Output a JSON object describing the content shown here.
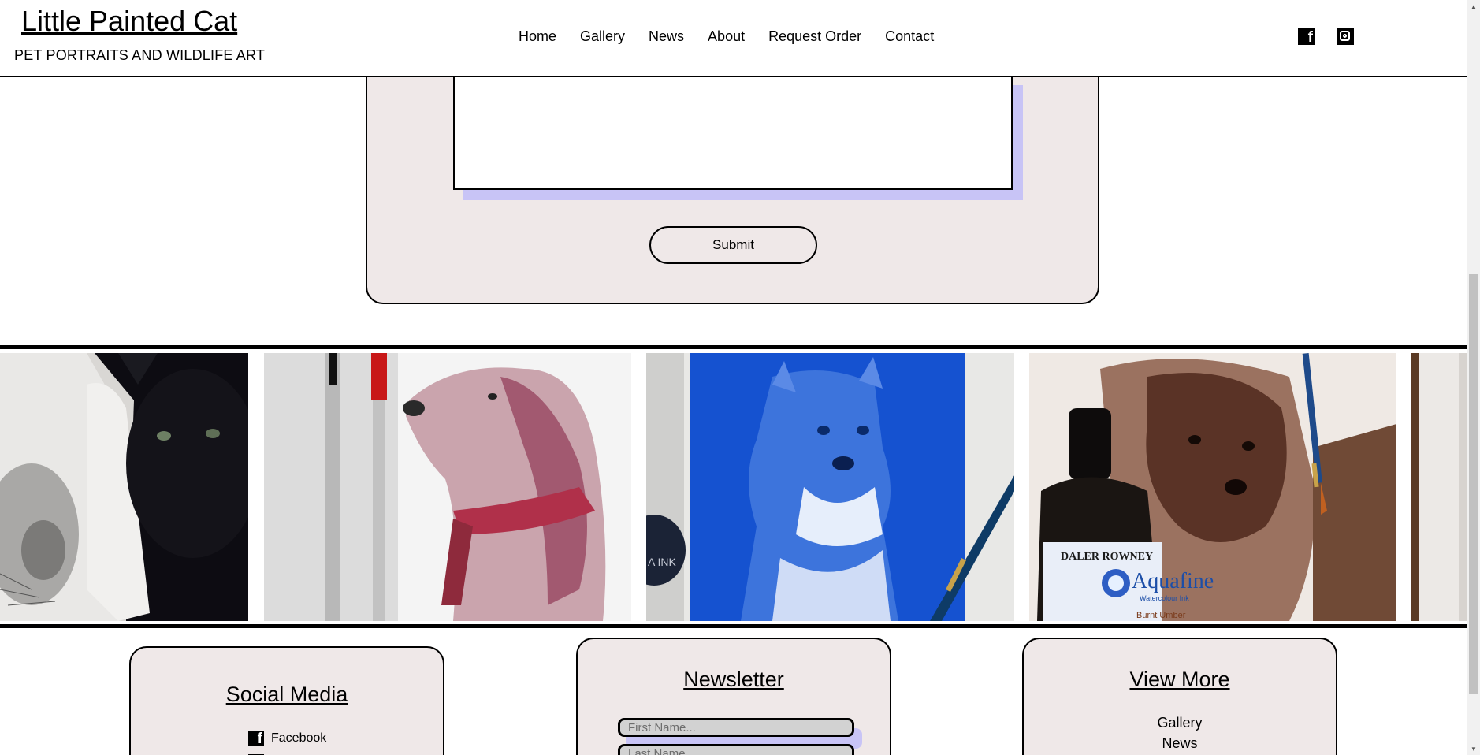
{
  "header": {
    "site_title": "Little Painted Cat",
    "tagline": "PET PORTRAITS AND WILDLIFE ART",
    "nav": [
      "Home",
      "Gallery",
      "News",
      "About",
      "Request Order",
      "Contact"
    ],
    "social_icons": [
      "facebook-icon",
      "instagram-icon"
    ]
  },
  "form": {
    "textarea_value": "",
    "submit_label": "Submit"
  },
  "gallery": {
    "tiles": [
      {
        "subject": "black cat beside a pencil drawing of a cat"
      },
      {
        "subject": "colored pencil drawing of a spaniel with pens"
      },
      {
        "subject": "blue watercolor of a mastiff-type dog"
      },
      {
        "subject": "sepia ink painting of a dog with Daler-Rowney Aquafine ink"
      },
      {
        "subject": "partial tile"
      }
    ],
    "ink_bottle_brand": "DALER ROWNEY",
    "ink_bottle_label": "Aquafine",
    "ink_bottle_sub": "Watercolour Ink",
    "ink_bottle_color": "Burnt Umber",
    "ink_jar_text": "A INK"
  },
  "footer": {
    "social": {
      "title": "Social Media",
      "items": [
        "Facebook"
      ]
    },
    "newsletter": {
      "title": "Newsletter",
      "first_name_placeholder": "First Name...",
      "last_name_placeholder": "Last Name..."
    },
    "view_more": {
      "title": "View More",
      "links": [
        "Gallery",
        "News"
      ]
    }
  },
  "colors": {
    "panel_bg": "#efe8e8",
    "shadow": "#c8c4f6",
    "border": "#000000"
  }
}
